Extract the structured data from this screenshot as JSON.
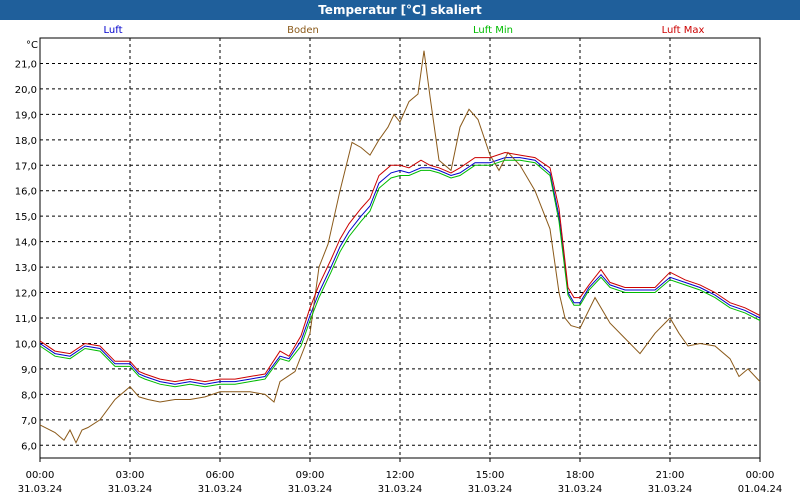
{
  "window": {
    "title": "Temperatur [°C] skaliert"
  },
  "chart_data": {
    "type": "line",
    "title": "Temperatur [°C] skaliert",
    "ylabel": "°C",
    "ylim": [
      5.5,
      22.0
    ],
    "yticks": [
      "6,0",
      "7,0",
      "8,0",
      "9,0",
      "10,0",
      "11,0",
      "12,0",
      "13,0",
      "14,0",
      "15,0",
      "16,0",
      "17,0",
      "18,0",
      "19,0",
      "20,0",
      "21,0"
    ],
    "xlim": [
      0,
      24
    ],
    "xticks": [
      {
        "time": "00:00",
        "date": "31.03.24"
      },
      {
        "time": "03:00",
        "date": "31.03.24"
      },
      {
        "time": "06:00",
        "date": "31.03.24"
      },
      {
        "time": "09:00",
        "date": "31.03.24"
      },
      {
        "time": "12:00",
        "date": "31.03.24"
      },
      {
        "time": "15:00",
        "date": "31.03.24"
      },
      {
        "time": "18:00",
        "date": "31.03.24"
      },
      {
        "time": "21:00",
        "date": "31.03.24"
      },
      {
        "time": "00:00",
        "date": "01.04.24"
      }
    ],
    "grid": true,
    "legend_position": "top",
    "series": [
      {
        "name": "Luft",
        "color": "#0000cc",
        "x": [
          0,
          0.5,
          1,
          1.5,
          2,
          2.5,
          3,
          3.3,
          3.5,
          4,
          4.5,
          5,
          5.5,
          6,
          6.5,
          7,
          7.5,
          8,
          8.3,
          8.7,
          9,
          9.3,
          9.7,
          10,
          10.3,
          10.7,
          11,
          11.3,
          11.7,
          12,
          12.3,
          12.7,
          13,
          13.3,
          13.7,
          14,
          14.5,
          15,
          15.5,
          16,
          16.5,
          17,
          17.3,
          17.6,
          17.8,
          18,
          18.3,
          18.7,
          19,
          19.5,
          20,
          20.5,
          21,
          21.5,
          22,
          22.5,
          23,
          23.5,
          24
        ],
        "y": [
          10.0,
          9.6,
          9.5,
          9.9,
          9.8,
          9.2,
          9.2,
          8.8,
          8.7,
          8.5,
          8.4,
          8.5,
          8.4,
          8.5,
          8.5,
          8.6,
          8.7,
          9.5,
          9.4,
          10.1,
          11.1,
          12.0,
          13.0,
          13.8,
          14.4,
          15.0,
          15.4,
          16.3,
          16.7,
          16.8,
          16.7,
          16.9,
          16.9,
          16.8,
          16.6,
          16.7,
          17.1,
          17.1,
          17.3,
          17.3,
          17.2,
          16.7,
          15.0,
          12.0,
          11.6,
          11.6,
          12.2,
          12.7,
          12.3,
          12.1,
          12.1,
          12.1,
          12.6,
          12.4,
          12.2,
          11.9,
          11.5,
          11.3,
          11.0
        ]
      },
      {
        "name": "Boden",
        "color": "#8b5a1a",
        "x": [
          0,
          0.5,
          0.8,
          1.0,
          1.2,
          1.4,
          1.6,
          2.0,
          2.5,
          3.0,
          3.3,
          3.6,
          4.0,
          4.5,
          5.0,
          5.5,
          6.0,
          6.5,
          7.0,
          7.5,
          7.8,
          8.0,
          8.5,
          9.0,
          9.3,
          9.6,
          10.0,
          10.4,
          10.7,
          11.0,
          11.3,
          11.6,
          11.8,
          12.0,
          12.3,
          12.6,
          12.8,
          13.0,
          13.3,
          13.7,
          14.0,
          14.3,
          14.6,
          15.0,
          15.3,
          15.6,
          16.0,
          16.5,
          17.0,
          17.3,
          17.5,
          17.7,
          18.0,
          18.5,
          19.0,
          19.5,
          20.0,
          20.5,
          21.0,
          21.3,
          21.6,
          22.0,
          22.5,
          23.0,
          23.3,
          23.6,
          24.0
        ],
        "y": [
          6.8,
          6.5,
          6.2,
          6.6,
          6.1,
          6.6,
          6.7,
          7.0,
          7.8,
          8.3,
          7.9,
          7.8,
          7.7,
          7.8,
          7.8,
          7.9,
          8.1,
          8.1,
          8.1,
          8.0,
          7.7,
          8.5,
          8.9,
          10.4,
          13.0,
          13.9,
          16.0,
          17.9,
          17.7,
          17.4,
          18.0,
          18.5,
          19.0,
          18.7,
          19.5,
          19.8,
          21.5,
          19.7,
          17.2,
          16.8,
          18.5,
          19.2,
          18.8,
          17.4,
          16.8,
          17.5,
          17.0,
          16.0,
          14.5,
          12.0,
          11.0,
          10.7,
          10.6,
          11.8,
          10.8,
          10.2,
          9.6,
          10.4,
          11.0,
          10.4,
          9.9,
          10.0,
          9.9,
          9.4,
          8.7,
          9.0,
          8.5
        ]
      },
      {
        "name": "Luft Min",
        "color": "#00bb00",
        "x": [
          0,
          0.5,
          1,
          1.5,
          2,
          2.5,
          3,
          3.3,
          3.5,
          4,
          4.5,
          5,
          5.5,
          6,
          6.5,
          7,
          7.5,
          8,
          8.3,
          8.7,
          9,
          9.3,
          9.7,
          10,
          10.3,
          10.7,
          11,
          11.3,
          11.7,
          12,
          12.3,
          12.7,
          13,
          13.3,
          13.7,
          14,
          14.5,
          15,
          15.5,
          16,
          16.5,
          17,
          17.3,
          17.6,
          17.8,
          18,
          18.3,
          18.7,
          19,
          19.5,
          20,
          20.5,
          21,
          21.5,
          22,
          22.5,
          23,
          23.5,
          24
        ],
        "y": [
          9.9,
          9.5,
          9.4,
          9.8,
          9.7,
          9.1,
          9.1,
          8.7,
          8.6,
          8.4,
          8.3,
          8.4,
          8.3,
          8.4,
          8.4,
          8.5,
          8.6,
          9.4,
          9.3,
          9.9,
          10.9,
          11.8,
          12.8,
          13.6,
          14.2,
          14.8,
          15.2,
          16.1,
          16.5,
          16.6,
          16.6,
          16.8,
          16.8,
          16.7,
          16.5,
          16.6,
          17.0,
          17.0,
          17.2,
          17.2,
          17.1,
          16.6,
          14.8,
          11.9,
          11.5,
          11.5,
          12.1,
          12.6,
          12.2,
          12.0,
          12.0,
          12.0,
          12.5,
          12.3,
          12.1,
          11.8,
          11.4,
          11.2,
          10.9
        ]
      },
      {
        "name": "Luft Max",
        "color": "#cc0000",
        "x": [
          0,
          0.5,
          1,
          1.5,
          2,
          2.5,
          3,
          3.3,
          3.5,
          4,
          4.5,
          5,
          5.5,
          6,
          6.5,
          7,
          7.5,
          8,
          8.3,
          8.7,
          9,
          9.3,
          9.7,
          10,
          10.3,
          10.7,
          11,
          11.3,
          11.7,
          12,
          12.3,
          12.7,
          13,
          13.3,
          13.7,
          14,
          14.5,
          15,
          15.5,
          16,
          16.5,
          17,
          17.3,
          17.6,
          17.8,
          18,
          18.3,
          18.7,
          19,
          19.5,
          20,
          20.5,
          21,
          21.5,
          22,
          22.5,
          23,
          23.5,
          24
        ],
        "y": [
          10.1,
          9.7,
          9.6,
          10.0,
          9.9,
          9.3,
          9.3,
          8.9,
          8.8,
          8.6,
          8.5,
          8.6,
          8.5,
          8.6,
          8.6,
          8.7,
          8.8,
          9.7,
          9.5,
          10.3,
          11.4,
          12.3,
          13.3,
          14.1,
          14.7,
          15.3,
          15.7,
          16.6,
          17.0,
          17.0,
          16.9,
          17.2,
          17.0,
          16.9,
          16.7,
          16.9,
          17.3,
          17.3,
          17.5,
          17.4,
          17.3,
          16.9,
          15.3,
          12.2,
          11.8,
          11.8,
          12.3,
          12.9,
          12.4,
          12.2,
          12.2,
          12.2,
          12.8,
          12.5,
          12.3,
          12.0,
          11.6,
          11.4,
          11.1
        ]
      }
    ]
  }
}
